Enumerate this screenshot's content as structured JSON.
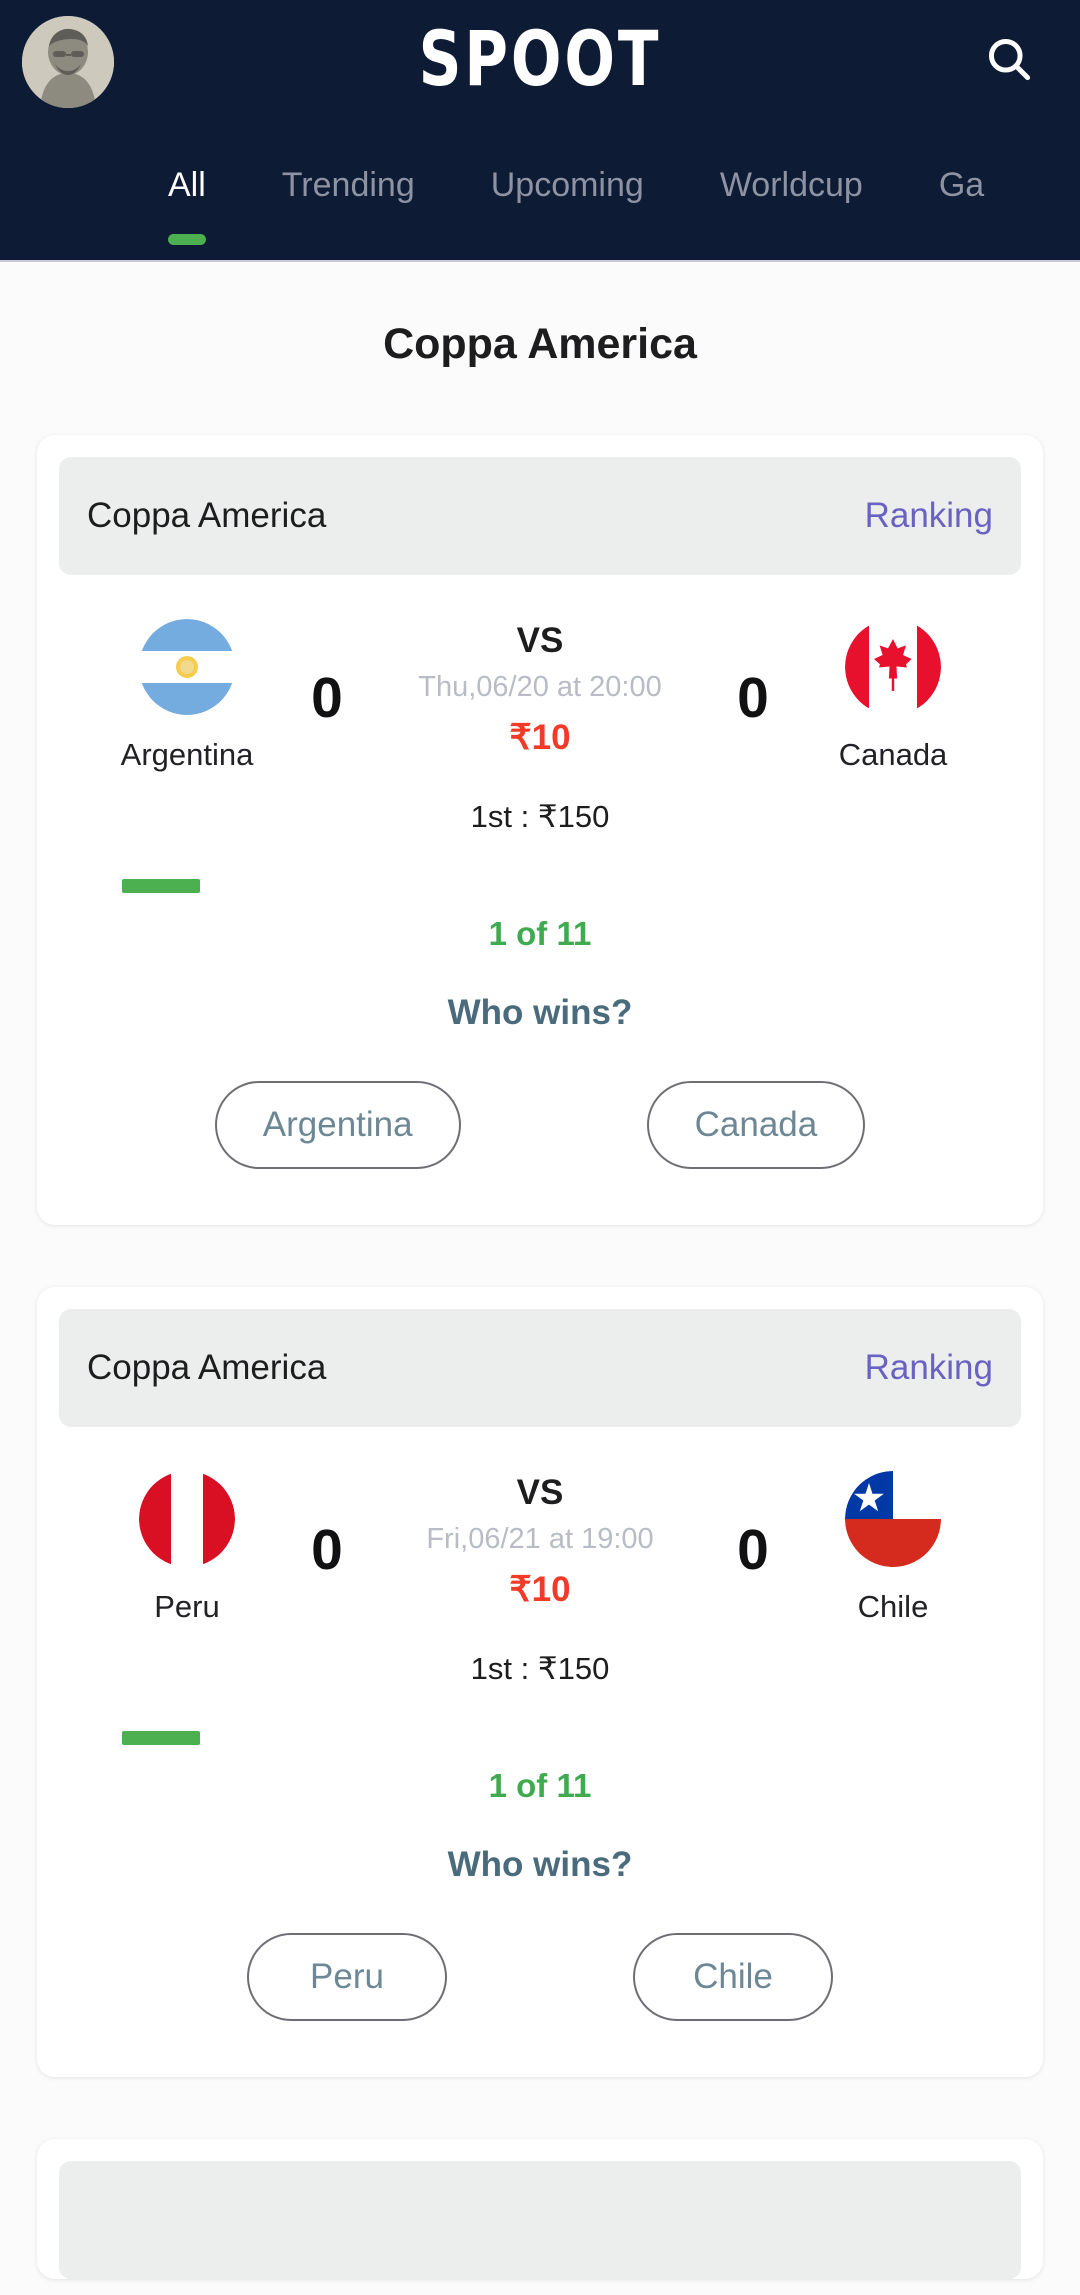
{
  "header": {
    "logo": "SPOOT",
    "avatar_icon": "user-avatar-portrait",
    "search_icon": "search-icon",
    "tabs": [
      {
        "label": "All",
        "active": true
      },
      {
        "label": "Trending",
        "active": false
      },
      {
        "label": "Upcoming",
        "active": false
      },
      {
        "label": "Worldcup",
        "active": false
      },
      {
        "label": "Ga",
        "active": false
      }
    ]
  },
  "main": {
    "page_title": "Coppa America",
    "cards": [
      {
        "head_title": "Coppa America",
        "head_link": "Ranking",
        "home_team": "Argentina",
        "home_flag": "argentina-flag-icon",
        "home_score": "0",
        "vs": "VS",
        "date": "Thu,06/20 at 20:00",
        "entry_fee": "₹10",
        "prize": "1st : ₹150",
        "away_team": "Canada",
        "away_flag": "canada-flag-icon",
        "away_score": "0",
        "progress_label": "1 of 11",
        "question": "Who wins?",
        "choice_left": "Argentina",
        "choice_right": "Canada"
      },
      {
        "head_title": "Coppa America",
        "head_link": "Ranking",
        "home_team": "Peru",
        "home_flag": "peru-flag-icon",
        "home_score": "0",
        "vs": "VS",
        "date": "Fri,06/21 at 19:00",
        "entry_fee": "₹10",
        "prize": "1st : ₹150",
        "away_team": "Chile",
        "away_flag": "chile-flag-icon",
        "away_score": "0",
        "progress_label": "1 of 11",
        "question": "Who wins?",
        "choice_left": "Peru",
        "choice_right": "Chile"
      }
    ],
    "third_card": {
      "head_title": "",
      "head_link": ""
    }
  },
  "colors": {
    "header_bg": "#0d1b34",
    "accent_green": "#4caf50",
    "link_purple": "#6a62c2",
    "fee_red": "#f23a28",
    "question_slate": "#4a6b7c",
    "card_head_bg": "#eceded",
    "page_bg": "#fbfbfb"
  }
}
